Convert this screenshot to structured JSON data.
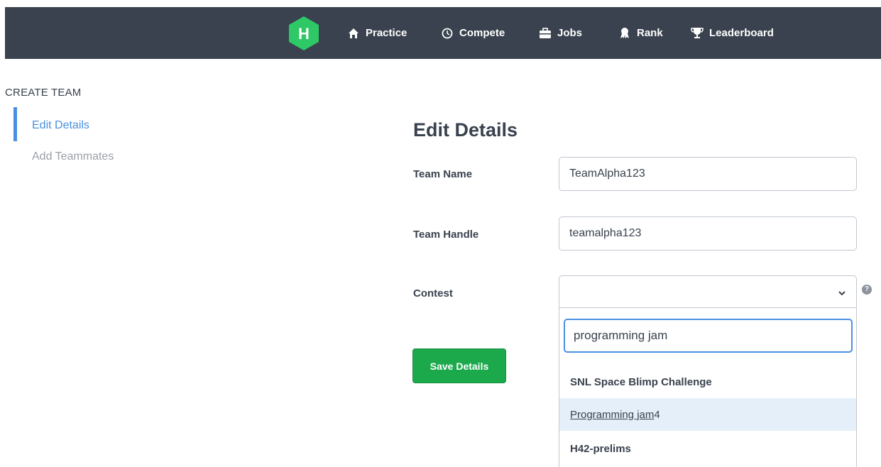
{
  "nav": {
    "logo_letter": "H",
    "items": [
      {
        "label": "Practice",
        "icon": "home-icon"
      },
      {
        "label": "Compete",
        "icon": "clock-icon"
      },
      {
        "label": "Jobs",
        "icon": "briefcase-icon"
      },
      {
        "label": "Rank",
        "icon": "medal-icon"
      },
      {
        "label": "Leaderboard",
        "icon": "trophy-icon"
      }
    ]
  },
  "sidebar": {
    "header": "CREATE TEAM",
    "items": [
      {
        "label": "Edit Details",
        "active": true
      },
      {
        "label": "Add Teammates",
        "active": false
      }
    ]
  },
  "main": {
    "title": "Edit Details",
    "team_name": {
      "label": "Team Name",
      "value": "TeamAlpha123"
    },
    "team_handle": {
      "label": "Team Handle",
      "value": "teamalpha123"
    },
    "contest": {
      "label": "Contest",
      "value": "",
      "help": "?",
      "search_value": "programming jam",
      "options": [
        {
          "label": "SNL Space Blimp Challenge"
        },
        {
          "label_match": "Programming jam ",
          "label_rest": "4"
        },
        {
          "label": "H42-prelims"
        }
      ]
    },
    "save_label": "Save Details"
  },
  "colors": {
    "topbar": "#39424e",
    "logo": "#2ec866",
    "primary_green": "#1ba94c",
    "link_blue": "#4a90e2",
    "highlight": "#e5effa"
  }
}
